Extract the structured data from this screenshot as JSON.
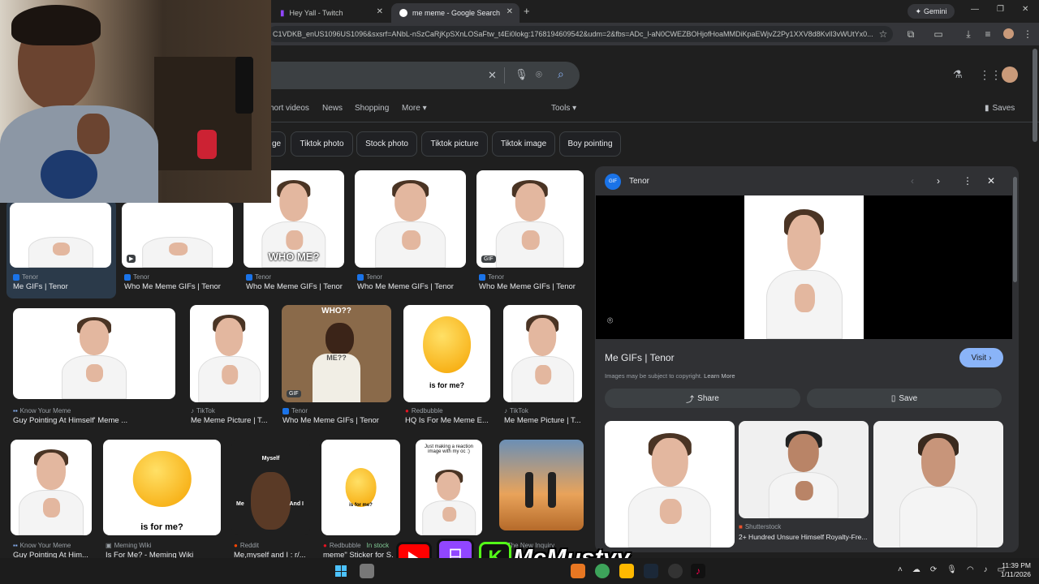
{
  "browser": {
    "tabs": [
      {
        "label": "Hey Yall - Twitch",
        "icon": "twitch-icon"
      },
      {
        "label": "me meme - Google Search",
        "icon": "google-icon"
      }
    ],
    "new_tab": "+",
    "gemini_label": "Gemini",
    "url": "C1VDKB_enUS1096US1096&sxsrf=ANbL-nSzCaRjKpSXnLOSaFtw_t4Ei0lokg:1768194609542&udm=2&fbs=ADc_l-aN0CWEZBOHjofHoaMMDiKpaEWjvZ2Py1XXV8d8KvlI3vWUtYx0..."
  },
  "search": {
    "nav": [
      "hort videos",
      "News",
      "Shopping",
      "More",
      "Tools"
    ],
    "saves_label": "Saves",
    "chips": [
      "ge",
      "Tiktok photo",
      "Stock photo",
      "Tiktok picture",
      "Tiktok image",
      "Boy pointing"
    ]
  },
  "results": {
    "row1": [
      {
        "source": "Tenor",
        "title": "Me GIFs | Tenor"
      },
      {
        "source": "Tenor",
        "title": "Who Me Meme GIFs | Tenor",
        "badge": "▶"
      },
      {
        "source": "Tenor",
        "title": "Who Me Meme GIFs | Tenor",
        "overlay": "WHO ME?"
      },
      {
        "source": "Tenor",
        "title": "Who Me Meme GIFs | Tenor"
      },
      {
        "source": "Tenor",
        "title": "Who Me Meme GIFs | Tenor",
        "badge": "GIF"
      }
    ],
    "row2": [
      {
        "source": "Know Your Meme",
        "title": "Guy Pointing At Himself' Meme ..."
      },
      {
        "source": "TikTok",
        "title": "Me Meme Picture | T..."
      },
      {
        "source": "Tenor",
        "title": "Who Me Meme GIFs | Tenor",
        "overlay_top": "WHO??",
        "overlay_mid": "ME??",
        "badge": "GIF"
      },
      {
        "source": "Redbubble",
        "title": "HQ Is For Me Meme E...",
        "overlay": "is for me?"
      },
      {
        "source": "TikTok",
        "title": "Me Meme Picture | T..."
      }
    ],
    "row3": [
      {
        "source": "Know Your Meme",
        "title": "Guy Pointing At Him..."
      },
      {
        "source": "Meming Wiki",
        "title": "Is For Me? - Meming Wiki",
        "overlay": "is for me?"
      },
      {
        "source": "Reddit",
        "title": "Me,myself and I : r/...",
        "overlay_top": "Myself",
        "overlay_mid": "Me",
        "overlay_right": "And I"
      },
      {
        "source": "Redbubble",
        "title": "meme\" Sticker for S...",
        "in_stock": "In stock",
        "overlay": "is for me?"
      },
      {
        "source": "",
        "title": "",
        "overlay_top": "Just making a reaction image with my oc :)"
      },
      {
        "source": "The New Inquiry",
        "title": ""
      }
    ]
  },
  "panel": {
    "source": "Tenor",
    "title": "Me GIFs | Tenor",
    "visit": "Visit",
    "copyright": "Images may be subject to copyright.",
    "learn_more": "Learn More",
    "share": "Share",
    "save": "Save",
    "related": [
      {
        "source": "",
        "title": ""
      },
      {
        "source": "Shutterstock",
        "title": "2+ Hundred Unsure Himself Royalty-Fre..."
      },
      {
        "source": "",
        "title": ""
      }
    ]
  },
  "overlay": {
    "channel": "McMustyy"
  },
  "taskbar": {
    "time": "11:39 PM",
    "date": "1/11/2026"
  },
  "colors": {
    "accent": "#8ab4f8",
    "visit_bg": "#8ab4f8",
    "twitch": "#9146ff",
    "youtube": "#ff0000",
    "kick": "#53fc18"
  }
}
